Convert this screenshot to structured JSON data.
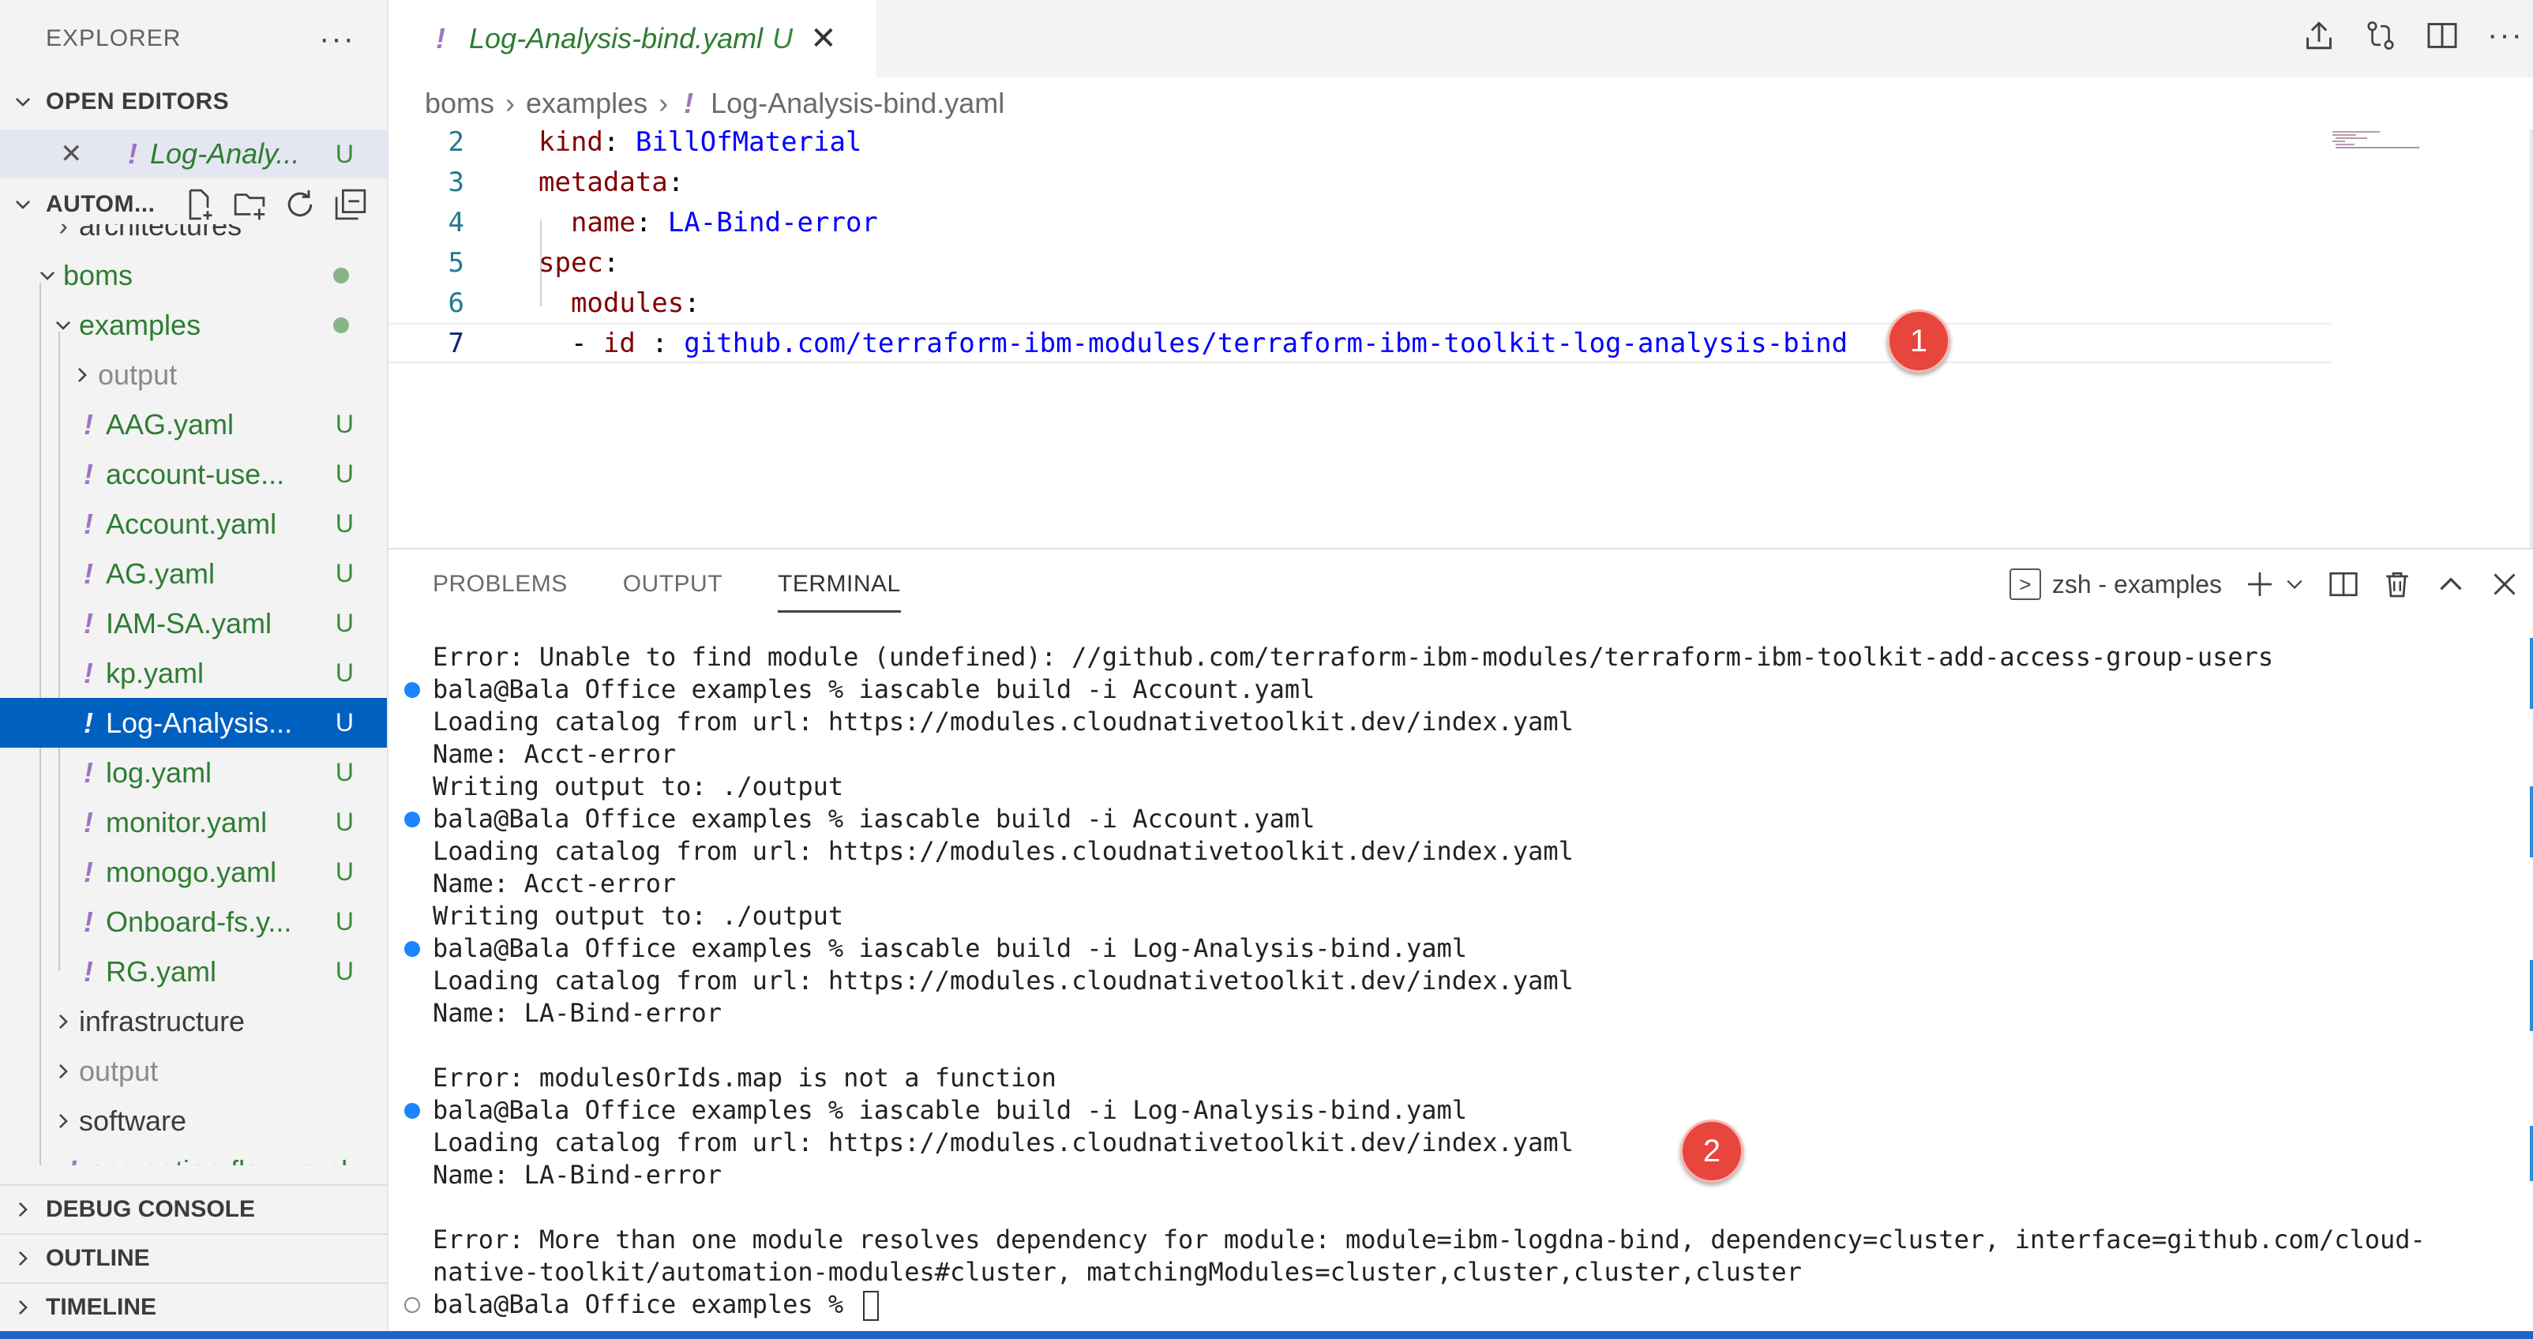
{
  "sidebar": {
    "title": "EXPLORER",
    "more": "···",
    "open_editors": {
      "label": "OPEN EDITORS",
      "items": [
        {
          "name": "Log-Analy...",
          "status": "U"
        }
      ]
    },
    "workspace": {
      "label": "AUTOM...",
      "tree": [
        {
          "label": "architectures"
        },
        {
          "label": "boms"
        },
        {
          "label": "examples"
        },
        {
          "label": "output"
        },
        {
          "label": "AAG.yaml",
          "status": "U"
        },
        {
          "label": "account-use...",
          "status": "U"
        },
        {
          "label": "Account.yaml",
          "status": "U"
        },
        {
          "label": "AG.yaml",
          "status": "U"
        },
        {
          "label": "IAM-SA.yaml",
          "status": "U"
        },
        {
          "label": "kp.yaml",
          "status": "U"
        },
        {
          "label": "Log-Analysis...",
          "status": "U"
        },
        {
          "label": "log.yaml",
          "status": "U"
        },
        {
          "label": "monitor.yaml",
          "status": "U"
        },
        {
          "label": "monogo.yaml",
          "status": "U"
        },
        {
          "label": "Onboard-fs.y...",
          "status": "U"
        },
        {
          "label": "RG.yaml",
          "status": "U"
        },
        {
          "label": "infrastructure"
        },
        {
          "label": "output"
        },
        {
          "label": "software"
        },
        {
          "label": "cecreation-flow.yaml"
        }
      ]
    },
    "bottom_sections": [
      "DEBUG CONSOLE",
      "OUTLINE",
      "TIMELINE"
    ]
  },
  "editor": {
    "tab": {
      "name": "Log-Analysis-bind.yaml",
      "status": "U"
    },
    "breadcrumb": [
      "boms",
      "examples",
      "Log-Analysis-bind.yaml"
    ],
    "lines": [
      {
        "num": "2",
        "key": "kind",
        "value": "BillOfMaterial"
      },
      {
        "num": "3",
        "key": "metadata",
        "value": ""
      },
      {
        "num": "4",
        "key": "name",
        "value": "LA-Bind-error"
      },
      {
        "num": "5",
        "key": "spec",
        "value": ""
      },
      {
        "num": "6",
        "key": "modules",
        "value": ""
      },
      {
        "num": "7",
        "key": "id",
        "value": "github.com/terraform-ibm-modules/terraform-ibm-toolkit-log-analysis-bind"
      }
    ],
    "marker_1": "1"
  },
  "panel": {
    "tabs": [
      "PROBLEMS",
      "OUTPUT",
      "TERMINAL"
    ],
    "active_tab": "TERMINAL",
    "terminal_name": "zsh - examples",
    "marker_2": "2",
    "terminal_lines": [
      "Error: Unable to find module (undefined): //github.com/terraform-ibm-modules/terraform-ibm-toolkit-add-access-group-users",
      "bala@Bala Office examples % iascable build -i Account.yaml",
      "Loading catalog from url: https://modules.cloudnativetoolkit.dev/index.yaml",
      "Name: Acct-error",
      "Writing output to: ./output",
      "bala@Bala Office examples % iascable build -i Account.yaml",
      "Loading catalog from url: https://modules.cloudnativetoolkit.dev/index.yaml",
      "Name: Acct-error",
      "Writing output to: ./output",
      "bala@Bala Office examples % iascable build -i Log-Analysis-bind.yaml",
      "Loading catalog from url: https://modules.cloudnativetoolkit.dev/index.yaml",
      "Name: LA-Bind-error",
      "",
      "Error: modulesOrIds.map is not a function",
      "bala@Bala Office examples % iascable build -i Log-Analysis-bind.yaml",
      "Loading catalog from url: https://modules.cloudnativetoolkit.dev/index.yaml",
      "Name: LA-Bind-error",
      "",
      "Error: More than one module resolves dependency for module: module=ibm-logdna-bind, dependency=cluster, interface=github.com/cloud-",
      "native-toolkit/automation-modules#cluster, matchingModules=cluster,cluster,cluster,cluster",
      "bala@Bala Office examples % "
    ]
  },
  "colors": {
    "selection": "#0060c0",
    "status_bar": "#1f63c3",
    "marker": "#e8453c",
    "untracked": "#388a34"
  }
}
